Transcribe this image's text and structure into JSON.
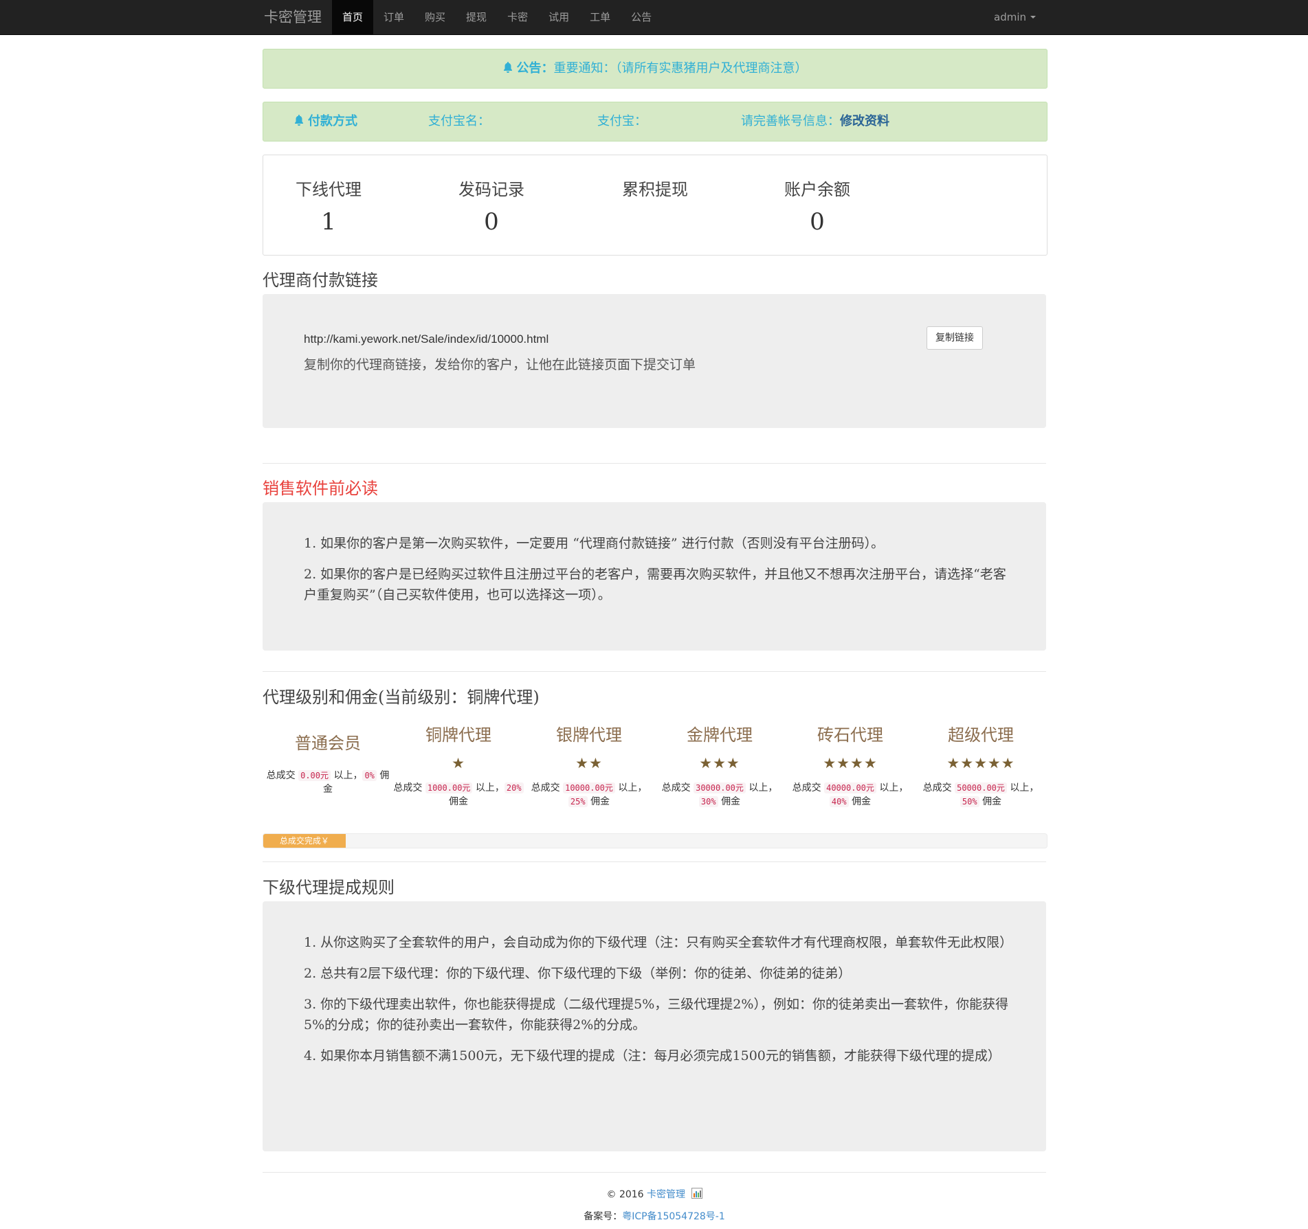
{
  "navbar": {
    "brand": "卡密管理",
    "items": [
      {
        "label": "首页",
        "active": true
      },
      {
        "label": "订单"
      },
      {
        "label": "购买"
      },
      {
        "label": "提现"
      },
      {
        "label": "卡密"
      },
      {
        "label": "试用"
      },
      {
        "label": "工单"
      },
      {
        "label": "公告"
      }
    ],
    "user": "admin"
  },
  "notice": {
    "label": "公告：",
    "text": "重要通知：（请所有实惠猪用户及代理商注意）"
  },
  "payment": {
    "title": "付款方式",
    "alipay_name_label": "支付宝名：",
    "alipay_label": "支付宝：",
    "complete_info_label": "请完善帐号信息：",
    "edit_link": "修改资料"
  },
  "stats": [
    {
      "label": "下线代理",
      "value": "1"
    },
    {
      "label": "发码记录",
      "value": "0"
    },
    {
      "label": "累积提现",
      "value": ""
    },
    {
      "label": "账户余额",
      "value": "0"
    }
  ],
  "agent_link": {
    "heading": "代理商付款链接",
    "url": "http://kami.yework.net/Sale/index/id/10000.html",
    "description": "复制你的代理商链接，发给你的客户，让他在此链接页面下提交订单",
    "copy_button": "复制链接"
  },
  "must_read": {
    "heading": "销售软件前必读",
    "items": [
      "1. 如果你的客户是第一次购买软件，一定要用 “代理商付款链接” 进行付款（否则没有平台注册码）。",
      "2. 如果你的客户是已经购买过软件且注册过平台的老客户，需要再次购买软件，并且他又不想再次注册平台，请选择“老客户重复购买”（自己买软件使用，也可以选择这一项）。"
    ]
  },
  "levels": {
    "heading": "代理级别和佣金(当前级别：铜牌代理)",
    "tiers": [
      {
        "name": "普通会员",
        "stars": "",
        "prefix": "总成交",
        "amount": "0.00元",
        "mid": "以上，",
        "rate": "0%",
        "suffix": "佣金"
      },
      {
        "name": "铜牌代理",
        "stars": "★",
        "prefix": "总成交",
        "amount": "1000.00元",
        "mid": "以上，",
        "rate": "20%",
        "suffix": "佣金"
      },
      {
        "name": "银牌代理",
        "stars": "★★",
        "prefix": "总成交",
        "amount": "10000.00元",
        "mid": "以上，",
        "rate": "25%",
        "suffix": "佣金"
      },
      {
        "name": "金牌代理",
        "stars": "★★★",
        "prefix": "总成交",
        "amount": "30000.00元",
        "mid": "以上，",
        "rate": "30%",
        "suffix": "佣金"
      },
      {
        "name": "砖石代理",
        "stars": "★★★★",
        "prefix": "总成交",
        "amount": "40000.00元",
        "mid": "以上，",
        "rate": "40%",
        "suffix": "佣金"
      },
      {
        "name": "超级代理",
        "stars": "★★★★★",
        "prefix": "总成交",
        "amount": "50000.00元",
        "mid": "以上，",
        "rate": "50%",
        "suffix": "佣金"
      }
    ],
    "progress_label": "总成交完成￥",
    "progress_percent": 10.5
  },
  "sub_rules": {
    "heading": "下级代理提成规则",
    "items": [
      "1. 从你这购买了全套软件的用户，会自动成为你的下级代理（注：只有购买全套软件才有代理商权限，单套软件无此权限）",
      "2. 总共有2层下级代理：你的下级代理、你下级代理的下级（举例：你的徒弟、你徒弟的徒弟）",
      "3. 你的下级代理卖出软件，你也能获得提成（二级代理提5%，三级代理提2%），例如：你的徒弟卖出一套软件，你能获得5%的分成；你的徒孙卖出一套软件，你能获得2%的分成。",
      "4. 如果你本月销售额不满1500元，无下级代理的提成（注：每月必须完成1500元的销售额，才能获得下级代理的提成）"
    ]
  },
  "footer": {
    "copyright": "© 2016",
    "site": "卡密管理",
    "icp_label": "备案号：",
    "icp": "粤ICP备15054728号-1"
  },
  "colors": {
    "navbar_bg": "#222222",
    "alert_bg": "#d6e9c6",
    "alert_text": "#31b0d5",
    "danger": "#e8413c",
    "progress": "#f0ad4e",
    "star": "#7a6134"
  }
}
